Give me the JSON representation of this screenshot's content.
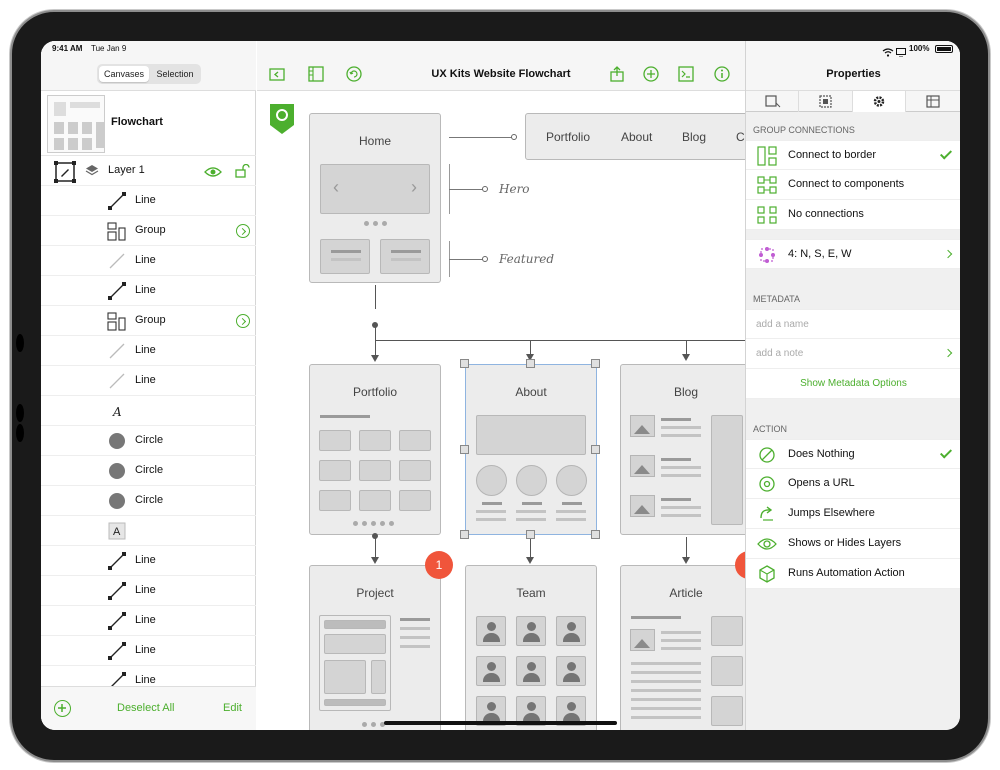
{
  "status": {
    "time": "9:41 AM",
    "date": "Tue Jan 9",
    "battery": "100%"
  },
  "left": {
    "tabs": [
      "Canvases",
      "Selection"
    ],
    "canvas_name": "Flowchart",
    "layer_name": "Layer 1",
    "items": [
      {
        "label": "Line",
        "icon": "line-icon"
      },
      {
        "label": "Group",
        "icon": "group-icon",
        "disclosure": true
      },
      {
        "label": "Line",
        "icon": "line-light-icon"
      },
      {
        "label": "Line",
        "icon": "line-icon"
      },
      {
        "label": "Group",
        "icon": "group-icon",
        "disclosure": true
      },
      {
        "label": "Line",
        "icon": "line-light-icon"
      },
      {
        "label": "Line",
        "icon": "line-light-icon"
      },
      {
        "label": "",
        "icon": "text-italic-icon"
      },
      {
        "label": "Circle",
        "icon": "circle-icon"
      },
      {
        "label": "Circle",
        "icon": "circle-icon"
      },
      {
        "label": "Circle",
        "icon": "circle-icon"
      },
      {
        "label": "",
        "icon": "text-box-icon"
      },
      {
        "label": "Line",
        "icon": "line-icon"
      },
      {
        "label": "Line",
        "icon": "line-icon"
      },
      {
        "label": "Line",
        "icon": "line-icon"
      },
      {
        "label": "Line",
        "icon": "line-icon"
      },
      {
        "label": "Line",
        "icon": "line-icon"
      }
    ],
    "text_glyph_italic": "A",
    "text_glyph_box": "A",
    "bottom": {
      "deselect": "Deselect All",
      "edit": "Edit"
    }
  },
  "center": {
    "title": "UX Kits Website Flowchart",
    "nav": [
      "Portfolio",
      "About",
      "Blog",
      "C"
    ],
    "notes": {
      "hero": "Hero",
      "featured": "Featured"
    },
    "cards": {
      "home": "Home",
      "portfolio": "Portfolio",
      "about": "About",
      "blog": "Blog",
      "project": "Project",
      "team": "Team",
      "article": "Article"
    },
    "badge_project": "1"
  },
  "right": {
    "title": "Properties",
    "group_connections_header": "GROUP CONNECTIONS",
    "connections": [
      {
        "label": "Connect to border",
        "checked": true
      },
      {
        "label": "Connect to components",
        "checked": false
      },
      {
        "label": "No connections",
        "checked": false
      }
    ],
    "magnets": "4: N, S, E, W",
    "metadata_header": "METADATA",
    "name_placeholder": "add a name",
    "note_placeholder": "add a note",
    "metadata_options": "Show Metadata Options",
    "action_header": "ACTION",
    "actions": [
      {
        "label": "Does Nothing",
        "checked": true
      },
      {
        "label": "Opens a URL",
        "checked": false
      },
      {
        "label": "Jumps Elsewhere",
        "checked": false
      },
      {
        "label": "Shows or Hides Layers",
        "checked": false
      },
      {
        "label": "Runs Automation Action",
        "checked": false
      }
    ]
  },
  "colors": {
    "accent": "#4caf2e",
    "badge": "#f0553b",
    "selection": "#8fb4e0"
  }
}
